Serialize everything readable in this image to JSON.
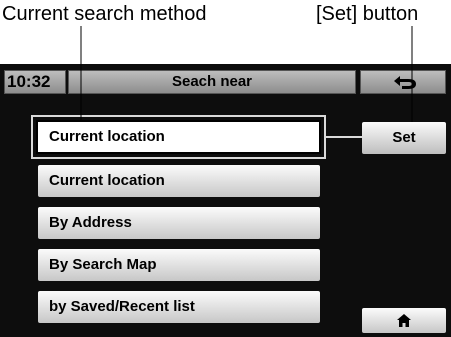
{
  "callouts": {
    "current_search_method": "Current search method",
    "set_button": "[Set] button"
  },
  "status_bar": {
    "time": "10:32",
    "title": "Seach near",
    "back_icon": "back-arrow-icon"
  },
  "current_method": {
    "label": "Current location"
  },
  "set_button": {
    "label": "Set"
  },
  "options": [
    {
      "label": "Current location"
    },
    {
      "label": "By Address"
    },
    {
      "label": "By Search Map"
    },
    {
      "label": "by Saved/Recent list"
    }
  ],
  "home_button": {
    "icon": "home-icon"
  }
}
